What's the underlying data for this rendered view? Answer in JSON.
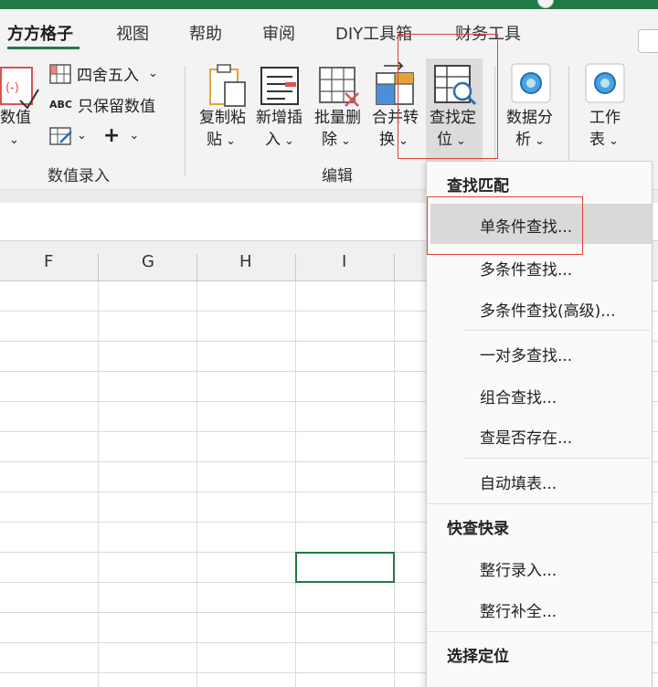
{
  "tabs": [
    {
      "label": "方方格子",
      "active": true
    },
    {
      "label": "视图"
    },
    {
      "label": "帮助"
    },
    {
      "label": "审阅"
    },
    {
      "label": "DIY工具箱"
    },
    {
      "label": "财务工具"
    }
  ],
  "ribbon": {
    "value_group": {
      "convert_label_line1": "数值",
      "round_label": "四舍五入",
      "keep_numbers_prefix": "ABC",
      "keep_numbers_label": "只保留数值",
      "group_label": "数值录入"
    },
    "edit_group": {
      "buttons": [
        {
          "line1": "复制粘",
          "line2": "贴"
        },
        {
          "line1": "新增插",
          "line2": "入"
        },
        {
          "line1": "批量删",
          "line2": "除"
        },
        {
          "line1": "合并转",
          "line2": "换"
        },
        {
          "line1": "查找定",
          "line2": "位"
        }
      ],
      "group_label": "编辑"
    },
    "analysis": {
      "line1": "数据分",
      "line2": "析"
    },
    "worksheet": {
      "line1": "工作",
      "line2": "表"
    }
  },
  "columns": [
    "F",
    "G",
    "H",
    "I"
  ],
  "menu": {
    "sections": [
      {
        "header": "查找匹配",
        "items": [
          "单条件查找...",
          "多条件查找...",
          "多条件查找(高级)...",
          "一对多查找...",
          "组合查找...",
          "查是否存在...",
          "自动填表..."
        ]
      },
      {
        "header": "快查快录",
        "items": [
          "整行录入...",
          "整行补全..."
        ]
      },
      {
        "header": "选择定位",
        "items": []
      }
    ]
  },
  "colors": {
    "accent": "#1f7a46",
    "highlight_box": "#e0433a"
  }
}
